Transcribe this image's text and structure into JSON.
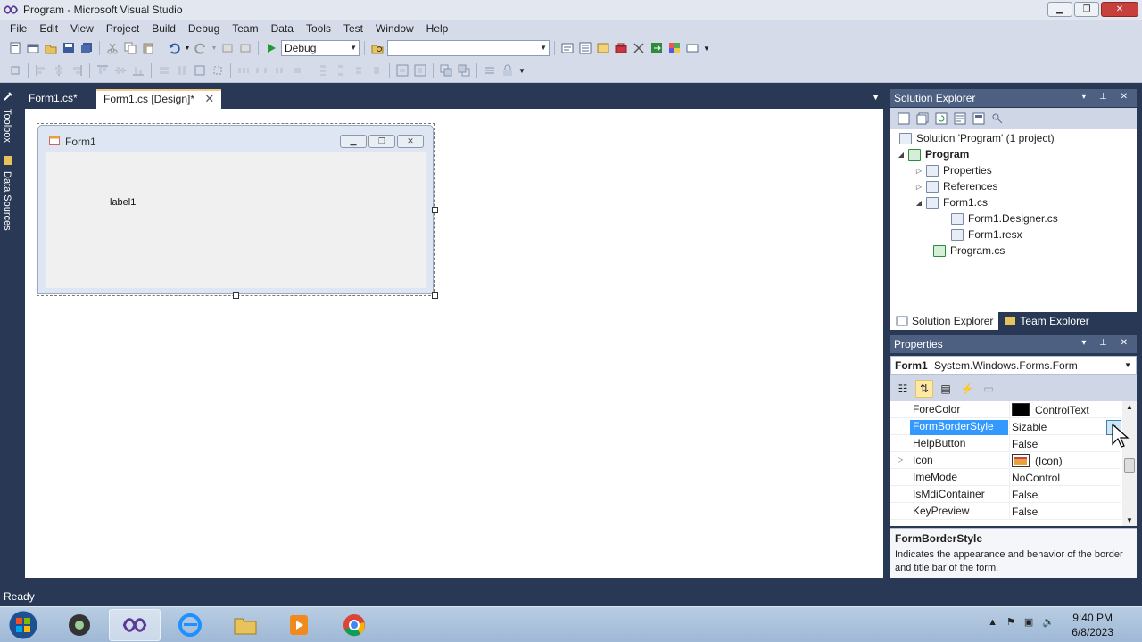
{
  "window": {
    "title": "Program - Microsoft Visual Studio",
    "minimize": "▁",
    "maximize": "❐",
    "close": "✕"
  },
  "menu": [
    "File",
    "Edit",
    "View",
    "Project",
    "Build",
    "Debug",
    "Team",
    "Data",
    "Tools",
    "Test",
    "Window",
    "Help"
  ],
  "toolbar": {
    "config_value": "Debug",
    "platform_value": ""
  },
  "left_dock": {
    "toolbox": "Toolbox",
    "data_sources": "Data Sources"
  },
  "doc_tabs": [
    {
      "label": "Form1.cs*"
    },
    {
      "label": "Form1.cs [Design]*"
    }
  ],
  "designer": {
    "form_title": "Form1",
    "label": "label1"
  },
  "solution_explorer": {
    "title": "Solution Explorer",
    "tree": [
      "Solution 'Program' (1 project)",
      "Program",
      "Properties",
      "References",
      "Form1.cs",
      "Form1.Designer.cs",
      "Form1.resx",
      "Program.cs"
    ],
    "tabs": [
      "Solution Explorer",
      "Team Explorer"
    ]
  },
  "properties": {
    "title": "Properties",
    "object_name": "Form1",
    "object_type": "System.Windows.Forms.Form",
    "rows": [
      {
        "name": "ForeColor",
        "value": "ControlText"
      },
      {
        "name": "FormBorderStyle",
        "value": "Sizable"
      },
      {
        "name": "HelpButton",
        "value": "False"
      },
      {
        "name": "Icon",
        "value": "(Icon)"
      },
      {
        "name": "ImeMode",
        "value": "NoControl"
      },
      {
        "name": "IsMdiContainer",
        "value": "False"
      },
      {
        "name": "KeyPreview",
        "value": "False"
      }
    ],
    "description_title": "FormBorderStyle",
    "description_text": "Indicates the appearance and behavior of the border and title bar of the form."
  },
  "status": "Ready",
  "clock": {
    "time": "9:40 PM",
    "date": "6/8/2023"
  },
  "colors": {
    "chrome": "#293955",
    "selection": "#3399ff",
    "forecolor_swatch": "#000000"
  }
}
